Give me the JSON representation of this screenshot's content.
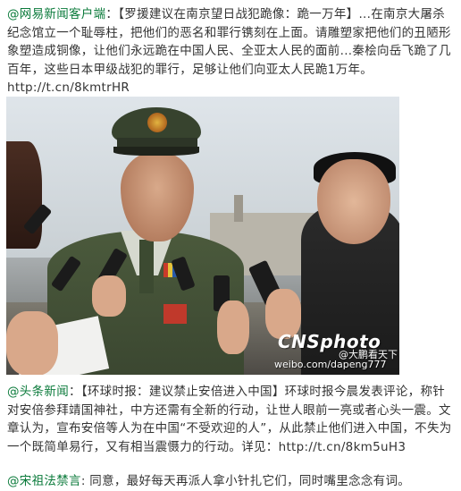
{
  "post1": {
    "author": "@网易新闻客户端",
    "sep": "：",
    "body": "【罗援建议在南京望日战犯跪像：跪一万年】...在南京大屠杀纪念馆立一个耻辱柱，把他们的恶名和罪行镌刻在上面。请雕塑家把他们的丑陋形象塑造成铜像，让他们永远跪在中国人民、全亚太人民的面前...秦桧向岳飞跪了几百年，这些日本甲级战犯的罪行，足够让他们向亚太人民跪1万年。",
    "link": "http://t.cn/8kmtrHR"
  },
  "photo": {
    "watermark_brand": "CNSphoto",
    "watermark_user": "@大鹏看天下",
    "watermark_url": "weibo.com/dapeng777"
  },
  "post2": {
    "author": "@头条新闻",
    "sep": "：",
    "body": "【环球时报：建议禁止安倍进入中国】环球时报今晨发表评论，称针对安倍参拜靖国神社，中方还需有全新的行动，让世人眼前一亮或者心头一震。文章认为，宣布安倍等人为在中国“不受欢迎的人”，从此禁止他们进入中国，不失为一个既简单易行，又有相当震慑力的行动。详见：",
    "link": "http://t.cn/8km5uH3"
  },
  "comment": {
    "author": "@宋祖法禁言",
    "sep": ": ",
    "body": "同意，最好每天再派人拿小针扎它们，同时嘴里念念有词。"
  }
}
